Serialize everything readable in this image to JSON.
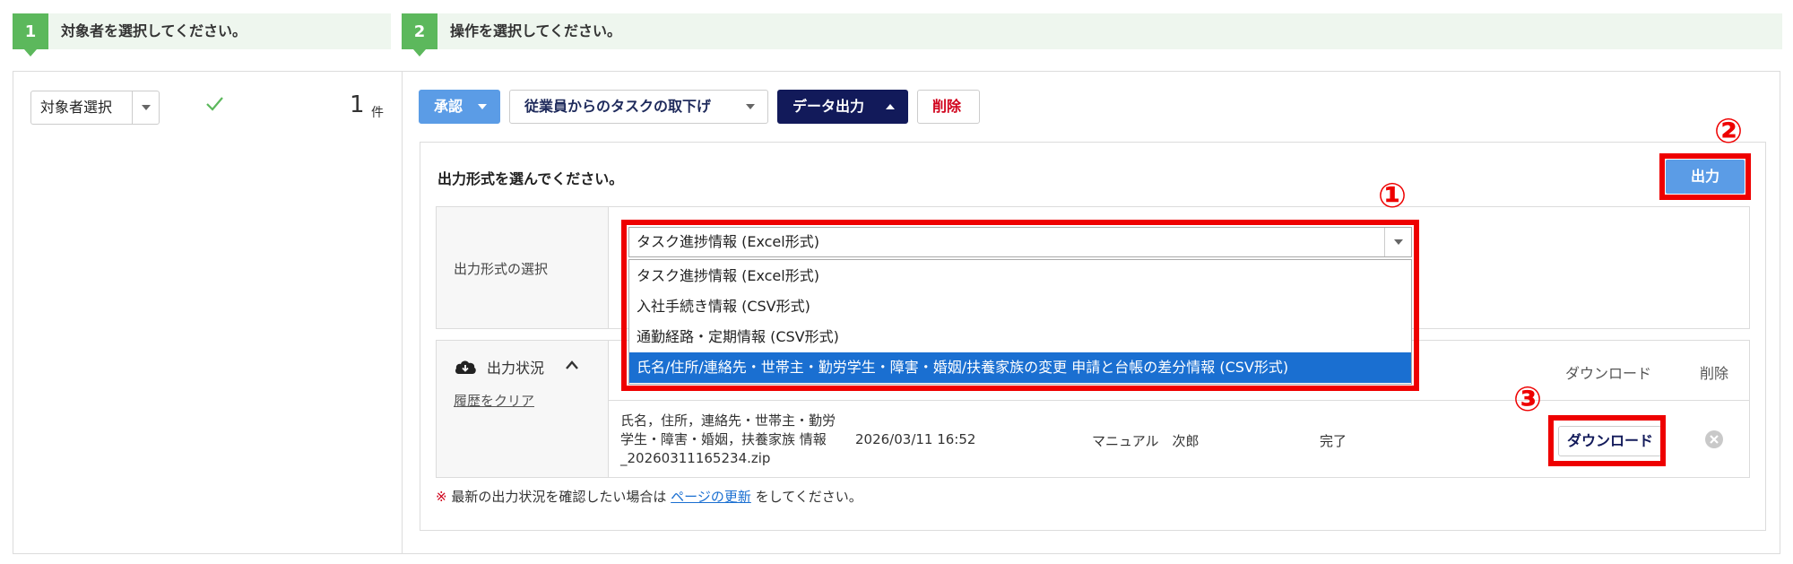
{
  "steps": [
    {
      "number": "1",
      "label": "対象者を選択してください。"
    },
    {
      "number": "2",
      "label": "操作を選択してください。"
    }
  ],
  "target": {
    "select_label": "対象者選択",
    "count": "1",
    "count_unit": "件"
  },
  "toolbar": {
    "approve": "承認",
    "withdraw": "従業員からのタスクの取下げ",
    "export": "データ出力",
    "delete": "削除"
  },
  "export_panel": {
    "heading": "出力形式を選んでください。",
    "output_button": "出力",
    "format_label": "出力形式の選択",
    "selected_format": "タスク進捗情報 (Excel形式)",
    "options": [
      "タスク進捗情報 (Excel形式)",
      "入社手続き情報 (CSV形式)",
      "通勤経路・定期情報 (CSV形式)",
      "氏名/住所/連絡先・世帯主・勤労学生・障害・婚姻/扶養家族の変更 申請と台帳の差分情報 (CSV形式)"
    ],
    "highlighted_option_index": 3
  },
  "status": {
    "title": "出力状況",
    "clear_history": "履歴をクリア",
    "columns": {
      "download": "ダウンロード",
      "delete": "削除"
    },
    "rows": [
      {
        "filename": "氏名，住所，連絡先・世帯主・勤労学生・障害・婚姻，扶養家族 情報_20260311165234.zip",
        "datetime": "2026/03/11 16:52",
        "user": "マニュアル　次郎",
        "state": "完了",
        "download_label": "ダウンロード"
      }
    ]
  },
  "note": {
    "mark": "※",
    "text_before": "最新の出力状況を確認したい場合は",
    "link": "ページの更新",
    "text_after": "をしてください。"
  },
  "annotations": {
    "badge_1": "①",
    "badge_2": "②",
    "badge_3": "③",
    "color": "#ee0000"
  },
  "colors": {
    "step_green": "#5cb85c",
    "approve_blue": "#5b9ce6",
    "export_navy": "#121a5a",
    "delete_red": "#d0021b",
    "option_selected": "#1a6fd1"
  }
}
